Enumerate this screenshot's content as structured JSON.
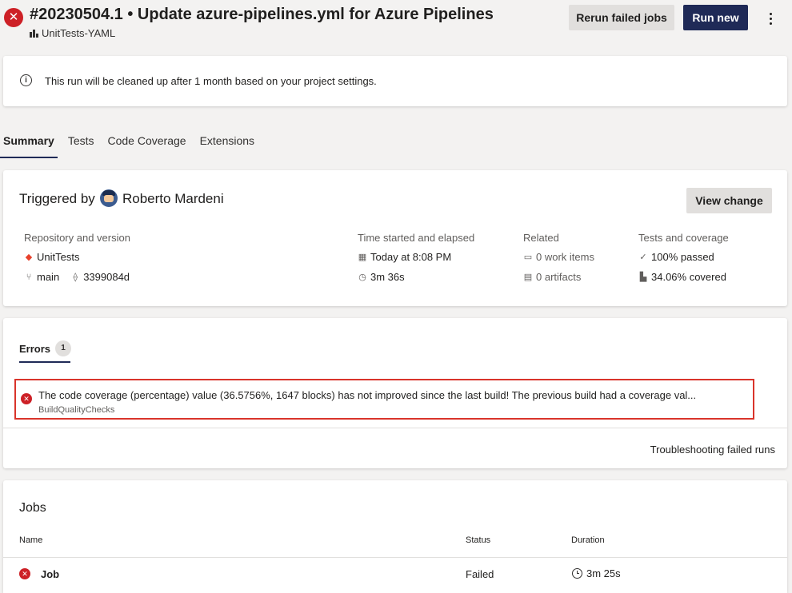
{
  "header": {
    "status_icon": "error-icon",
    "title": "#20230504.1 • Update azure-pipelines.yml for Azure Pipelines",
    "pipeline_name": "UnitTests-YAML",
    "rerun_label": "Rerun failed jobs",
    "run_new_label": "Run new"
  },
  "notice": {
    "text": "This run will be cleaned up after 1 month based on your project settings."
  },
  "tabs": [
    {
      "label": "Summary",
      "active": true
    },
    {
      "label": "Tests",
      "active": false
    },
    {
      "label": "Code Coverage",
      "active": false
    },
    {
      "label": "Extensions",
      "active": false
    }
  ],
  "summary": {
    "triggered_by_label": "Triggered by",
    "user_name": "Roberto Mardeni",
    "view_change_label": "View change",
    "repo_header": "Repository and version",
    "repo_name": "UnitTests",
    "branch": "main",
    "commit": "3399084d",
    "time_header": "Time started and elapsed",
    "started": "Today at 8:08 PM",
    "elapsed": "3m 36s",
    "related_header": "Related",
    "work_items": "0 work items",
    "artifacts": "0 artifacts",
    "tests_header": "Tests and coverage",
    "tests_passed": "100% passed",
    "coverage": "34.06% covered"
  },
  "errors": {
    "tab_label": "Errors",
    "count": "1",
    "message": "The code coverage (percentage) value (36.5756%, 1647 blocks) has not improved since the last build! The previous build had a coverage val...",
    "source": "BuildQualityChecks",
    "troubleshoot_label": "Troubleshooting failed runs"
  },
  "jobs": {
    "title": "Jobs",
    "columns": [
      "Name",
      "Status",
      "Duration"
    ],
    "rows": [
      {
        "name": "Job",
        "status": "Failed",
        "duration": "3m 25s"
      }
    ]
  },
  "colors": {
    "error": "#cd2026",
    "primary": "#1f2a57",
    "highlight_border": "#d9342b",
    "background": "#f3f2f1"
  }
}
